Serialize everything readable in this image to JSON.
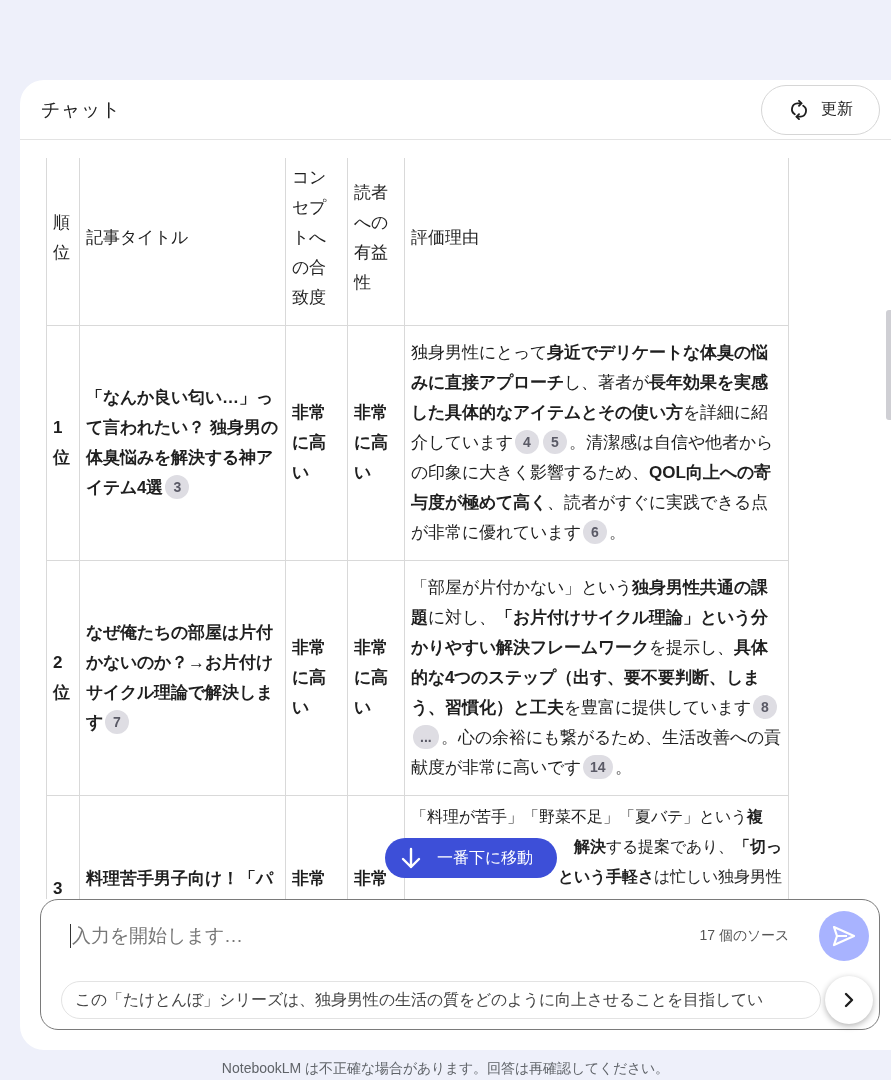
{
  "header": {
    "title": "チャット",
    "refresh_button": "更新"
  },
  "table": {
    "columns": [
      "順位",
      "記事タイトル",
      "コンセプトへの合致度",
      "読者への有益性",
      "評価理由"
    ],
    "rows": [
      {
        "rank": "1位",
        "title": [
          {
            "kind": "text",
            "text": "「なんか良い匂い…」って言われたい？ 独身男の体臭悩みを解決する神アイテム4選"
          },
          {
            "kind": "cite",
            "text": "3"
          }
        ],
        "concept": "非常に高い",
        "reader": "非常に高い",
        "reason": [
          {
            "kind": "text",
            "text": "独身男性にとって"
          },
          {
            "kind": "bold",
            "text": "身近でデリケートな体臭の悩みに直接アプローチ"
          },
          {
            "kind": "text",
            "text": "し、著者が"
          },
          {
            "kind": "bold",
            "text": "長年効果を実感した具体的なアイテムとその使い方"
          },
          {
            "kind": "text",
            "text": "を詳細に紹介しています"
          },
          {
            "kind": "cite",
            "text": "4"
          },
          {
            "kind": "cite",
            "text": "5"
          },
          {
            "kind": "text",
            "text": "。清潔感は自信や他者からの印象に大きく影響するため、"
          },
          {
            "kind": "bold",
            "text": "QOL向上への寄与度が極めて高く"
          },
          {
            "kind": "text",
            "text": "、読者がすぐに実践できる点が非常に優れています"
          },
          {
            "kind": "cite",
            "text": "6"
          },
          {
            "kind": "text",
            "text": "。"
          }
        ]
      },
      {
        "rank": "2位",
        "title": [
          {
            "kind": "text",
            "text": "なぜ俺たちの部屋は片付かないのか？→お片付けサイクル理論で解決します"
          },
          {
            "kind": "cite",
            "text": "7"
          }
        ],
        "concept": "非常に高い",
        "reader": "非常に高い",
        "reason": [
          {
            "kind": "text",
            "text": "「部屋が片付かない」という"
          },
          {
            "kind": "bold",
            "text": "独身男性共通の課題"
          },
          {
            "kind": "text",
            "text": "に対し、"
          },
          {
            "kind": "bold",
            "text": "「お片付けサイクル理論」という分かりやすい解決フレームワーク"
          },
          {
            "kind": "text",
            "text": "を提示し、"
          },
          {
            "kind": "bold",
            "text": "具体的な4つのステップ（出す、要不要判断、しまう、習慣化）と工夫"
          },
          {
            "kind": "text",
            "text": "を豊富に提供しています"
          },
          {
            "kind": "cite",
            "text": "8"
          },
          {
            "kind": "cite",
            "text": "..."
          },
          {
            "kind": "text",
            "text": "。心の余裕にも繋がるため、生活改善への貢献度が非常に高いです"
          },
          {
            "kind": "cite",
            "text": "14"
          },
          {
            "kind": "text",
            "text": "。"
          }
        ]
      },
      {
        "rank": "3",
        "title": [
          {
            "kind": "text",
            "text": "料理苦手男子向け！「パ"
          }
        ],
        "concept": "非常",
        "reader": "非常",
        "reason_lines": [
          [
            {
              "kind": "text",
              "text": "「料理が苦手」「野菜不足」「夏バテ」という"
            },
            {
              "kind": "bold",
              "text": "複"
            }
          ],
          [
            {
              "kind": "bold",
              "text": "解決"
            },
            {
              "kind": "text",
              "text": "する提案であり、"
            },
            {
              "kind": "bold",
              "text": "「切っ"
            }
          ],
          [
            {
              "kind": "bold",
              "text": "という手軽さ"
            },
            {
              "kind": "text",
              "text": "は忙しい独身男性"
            }
          ]
        ]
      }
    ]
  },
  "jump_button": "一番下に移動",
  "composer": {
    "placeholder": "入力を開始します…",
    "source_count": "17 個のソース",
    "suggestion": "この「たけとんぼ」シリーズは、独身男性の生活の質をどのように向上させることを目指してい"
  },
  "disclaimer": "NotebookLM は不正確な場合があります。回答は再確認してください。"
}
